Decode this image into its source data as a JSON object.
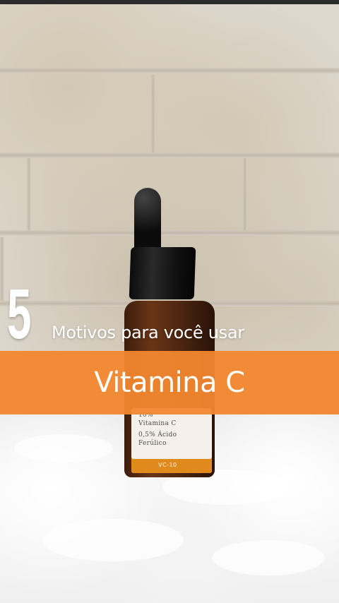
{
  "overlay": {
    "number": "5",
    "subtitle": "Motivos para você usar",
    "band_title": "Vitamina C",
    "band_color": "#f2872f"
  },
  "product_label": {
    "line1": "10%",
    "line2": "Vitamina C",
    "line3": "0,5% Ácido",
    "line4": "Ferúlico",
    "code": "VC-10"
  }
}
